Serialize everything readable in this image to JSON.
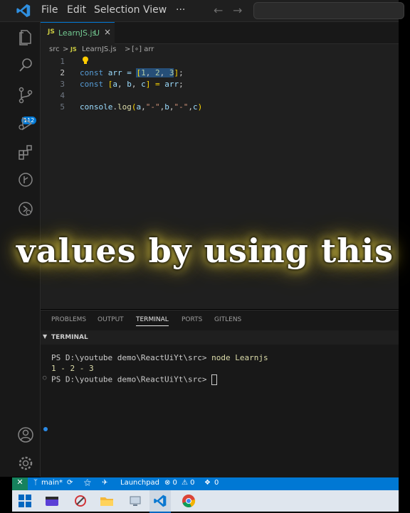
{
  "app": {
    "menu": [
      "File",
      "Edit",
      "Selection",
      "View",
      "···"
    ],
    "nav": [
      "←",
      "→"
    ]
  },
  "activity_bar": {
    "source_control_badge": "112",
    "icons": [
      "explorer-icon",
      "search-icon",
      "source-control-icon",
      "run-debug-icon",
      "extensions-icon",
      "gitlens-icon",
      "remote-icon",
      "account-icon",
      "settings-gear-icon"
    ]
  },
  "editor": {
    "tab": {
      "lang": "JS",
      "name": "LearnJS.js",
      "status": "U",
      "close": "×"
    },
    "breadcrumb": [
      "src",
      ">",
      "JS",
      "LearnJS.js",
      ">",
      "[∘] arr"
    ],
    "line_numbers": [
      "1",
      "2",
      "3",
      "4",
      "5"
    ],
    "code": {
      "l2": {
        "kw": "const",
        "name": " arr = ",
        "open": "[",
        "v1": "1",
        "c1": ", ",
        "v2": "2",
        "c2": ", ",
        "v3": "3",
        "close": "]",
        "end": ";"
      },
      "l3": {
        "kw": "const",
        "rest_open": " [",
        "a": "a",
        "c1": ", ",
        "b": "b",
        "c2": ", ",
        "c": "c",
        "rest_close": "] = ",
        "arr": "arr",
        "end": ";"
      },
      "l5": {
        "obj": "console",
        "dot": ".",
        "fn": "log",
        "open": "(",
        "a": "a",
        "c1": ",",
        "s1": "\"-\"",
        "c2": ",",
        "b": "b",
        "c3": ",",
        "s2": "\"-\"",
        "c4": ",",
        "c": "c",
        "close": ")"
      }
    }
  },
  "panel": {
    "tabs": [
      "PROBLEMS",
      "OUTPUT",
      "TERMINAL",
      "PORTS",
      "GITLENS"
    ],
    "active_tab": "TERMINAL",
    "section_title": "TERMINAL",
    "terminal": {
      "prompt1": "PS D:\\youtube demo\\ReactUiYt\\src> ",
      "cmd1": "node Learnjs",
      "output": "1 - 2 - 3",
      "prompt2": "PS D:\\youtube demo\\ReactUiYt\\src> "
    }
  },
  "caption": "values by using this",
  "status_bar": {
    "remote": "✕",
    "branch": "main*",
    "sync": "⟳",
    "launchpad": "Launchpad",
    "errors": "⊗ 0",
    "warnings": "⚠ 0",
    "ports": "0"
  },
  "colors": {
    "accent": "#0078d4",
    "editor_bg": "#1f1f1f",
    "caption_glow": "#d8c84a"
  }
}
